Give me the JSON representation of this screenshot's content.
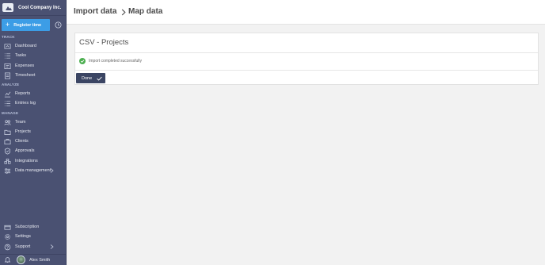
{
  "company": {
    "name": "Cool Company Inc.",
    "logo_icon": "cloud-logo-icon"
  },
  "register": {
    "label": "Register time",
    "icon": "plus-icon",
    "clock_icon": "clock-icon"
  },
  "sections": {
    "track": "TRACK",
    "analyze": "ANALYZE",
    "manage": "MANAGE"
  },
  "nav": {
    "dashboard": "Dashboard",
    "tasks": "Tasks",
    "expenses": "Expenses",
    "timesheet": "Timesheet",
    "reports": "Reports",
    "entries_log": "Entries log",
    "team": "Team",
    "projects": "Projects",
    "clients": "Clients",
    "approvals": "Approvals",
    "integrations": "Integrations",
    "data_management": "Data management",
    "subscription": "Subscription",
    "settings": "Settings",
    "support": "Support"
  },
  "user": {
    "name": "Alex Smith",
    "bell_icon": "bell-icon"
  },
  "header": {
    "crumb1": "Import data",
    "crumb2": "Map data",
    "separator_icon": "chevron-right-icon"
  },
  "card": {
    "title": "CSV - Projects",
    "status_text": "Import completed successfully",
    "status_icon": "check-circle-icon",
    "done_label": "Done",
    "done_icon": "check-icon"
  },
  "colors": {
    "sidebar": "#4a5172",
    "accent": "#3c9de6",
    "done_button": "#3b4563",
    "success": "#4caf50"
  }
}
